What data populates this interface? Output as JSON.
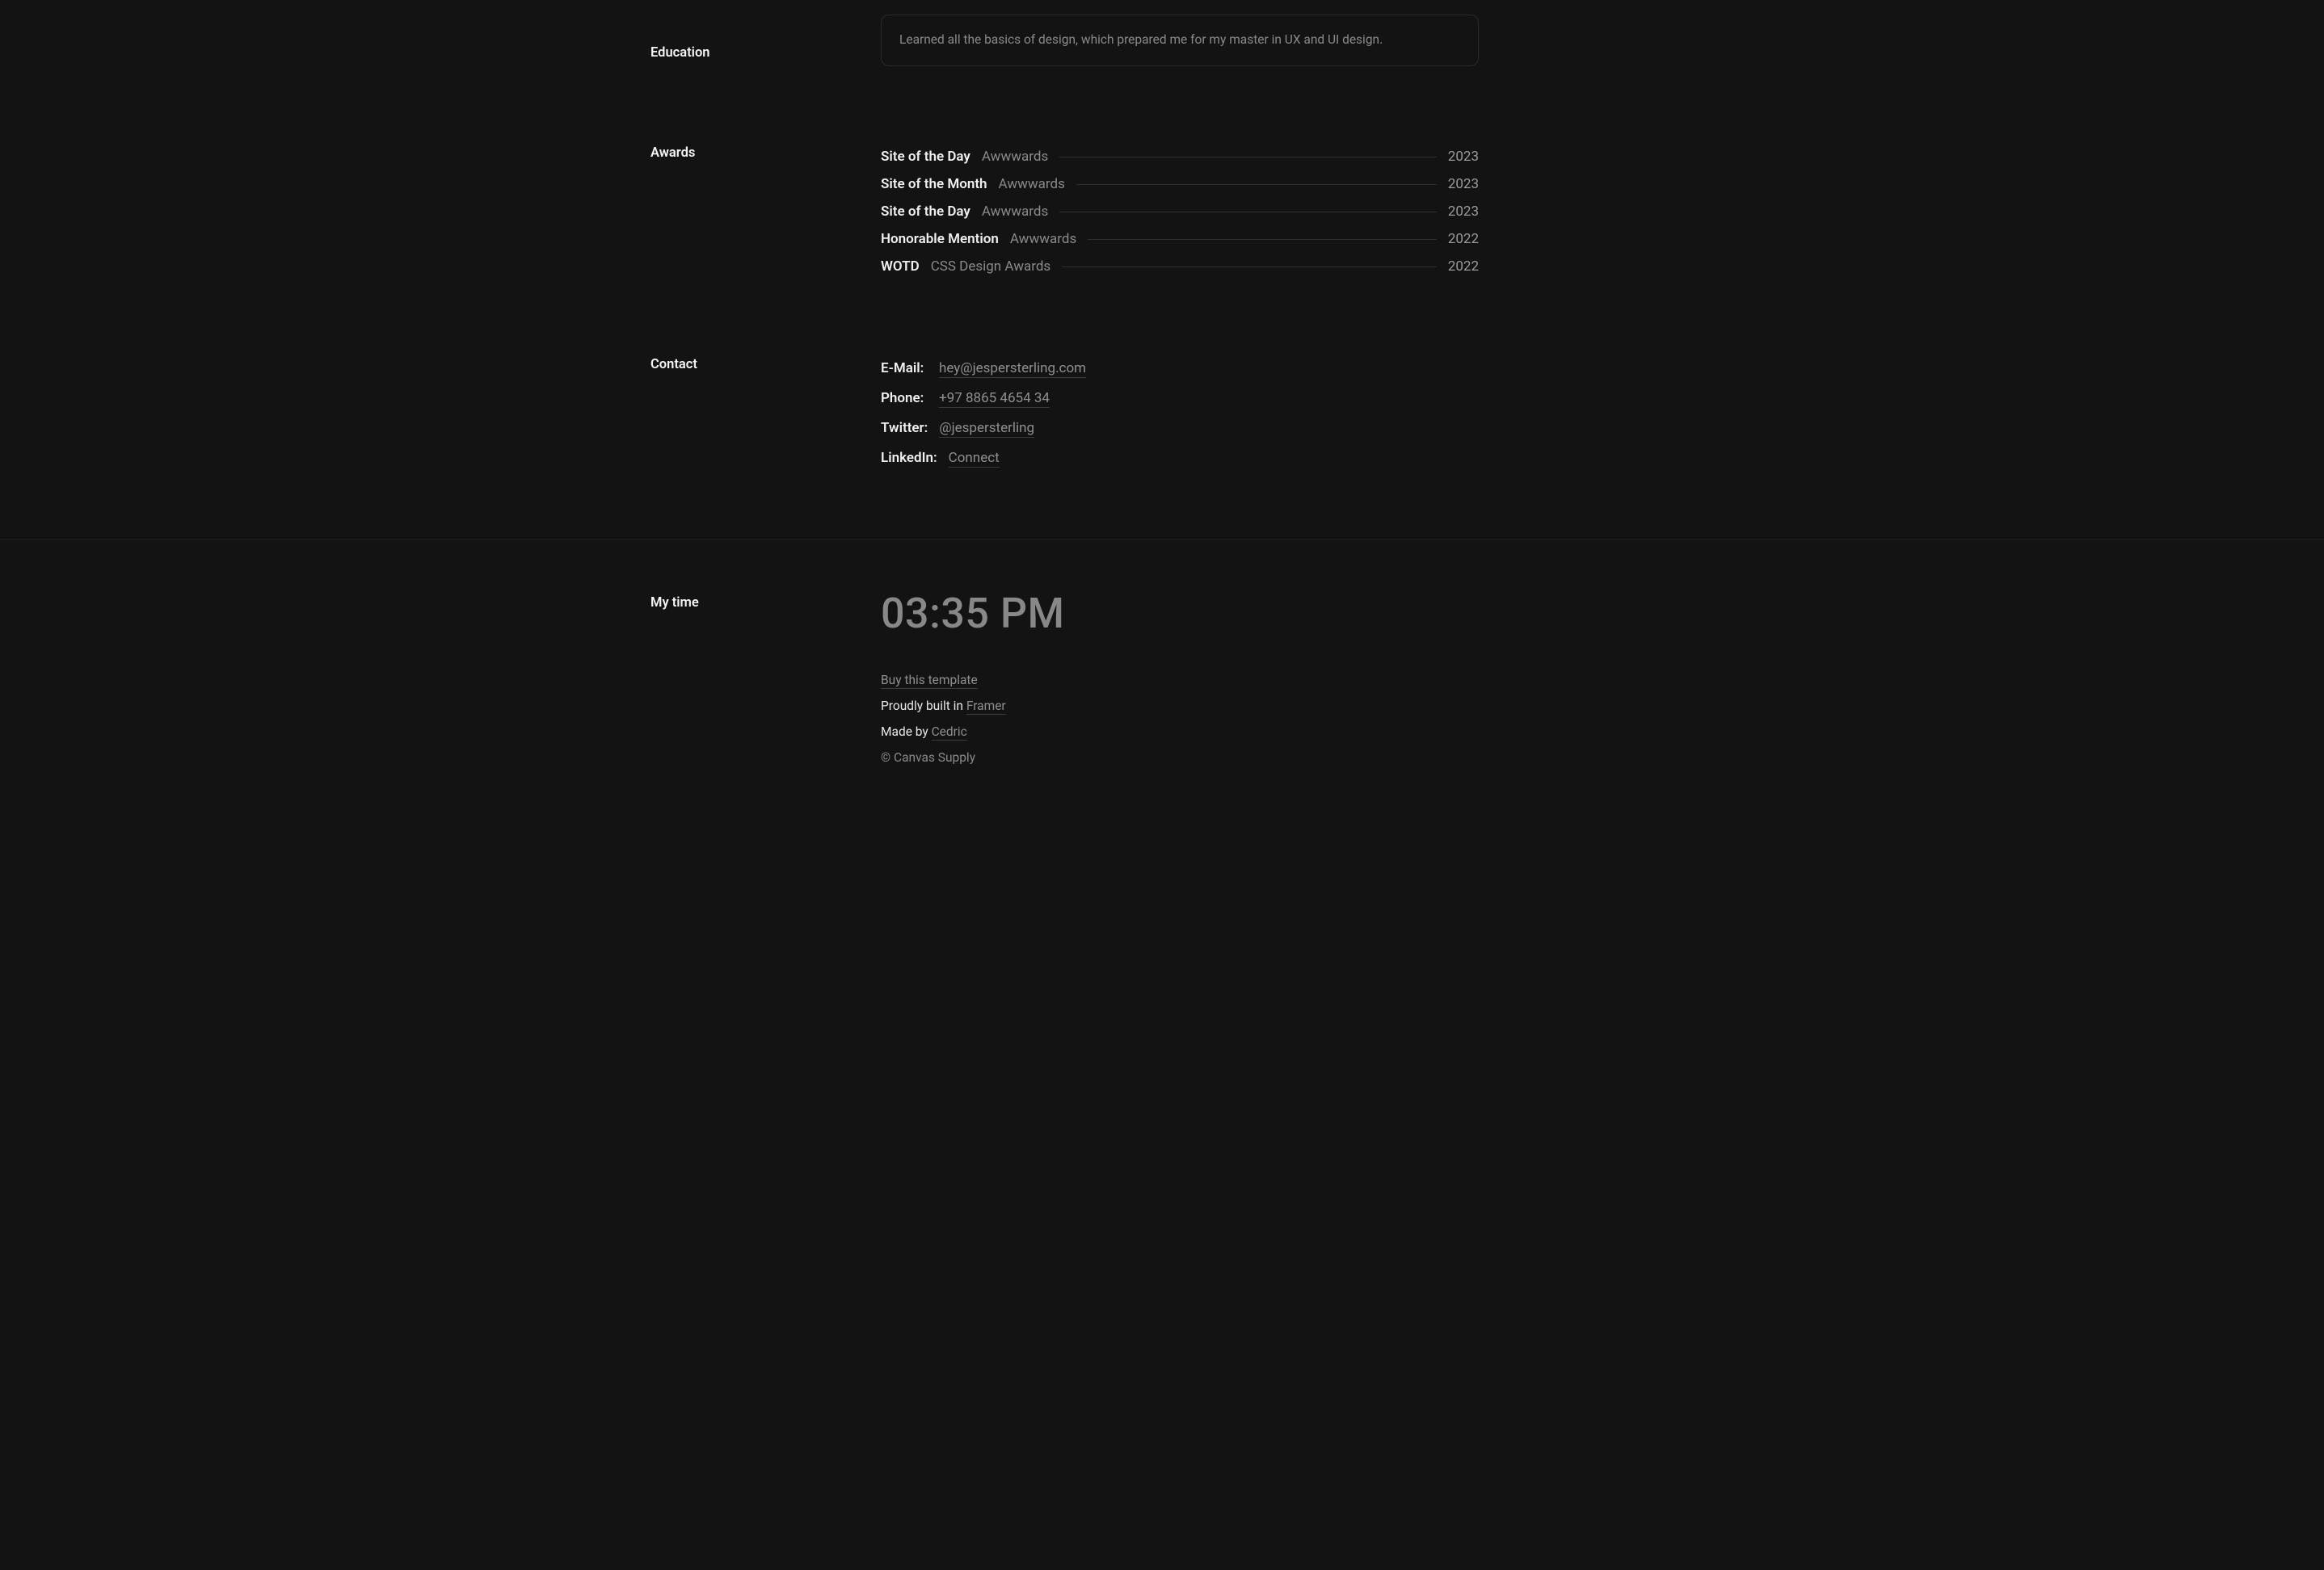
{
  "education": {
    "label": "Education",
    "card_text": "Learned all the basics of design, which prepared me for my master in UX and UI design."
  },
  "awards": {
    "label": "Awards",
    "items": [
      {
        "title": "Site of the Day",
        "org": "Awwwards",
        "year": "2023"
      },
      {
        "title": "Site of the Month",
        "org": "Awwwards",
        "year": "2023"
      },
      {
        "title": "Site of the Day",
        "org": "Awwwards",
        "year": "2023"
      },
      {
        "title": "Honorable Mention",
        "org": "Awwwards",
        "year": "2022"
      },
      {
        "title": "WOTD",
        "org": "CSS Design Awards",
        "year": "2022"
      }
    ]
  },
  "contact": {
    "label": "Contact",
    "items": [
      {
        "key": "E-Mail:",
        "val": "hey@jespersterling.com"
      },
      {
        "key": "Phone:",
        "val": "+97 8865 4654 34"
      },
      {
        "key": "Twitter:",
        "val": "@jespersterling"
      },
      {
        "key": "LinkedIn:",
        "val": "Connect"
      }
    ]
  },
  "mytime": {
    "label": "My time",
    "value": "03:35 PM"
  },
  "footer": {
    "buy": "Buy this template",
    "built_prefix": "Proudly built in ",
    "built_link": "Framer",
    "made_prefix": "Made by ",
    "made_link": "Cedric",
    "copyright": "© Canvas Supply"
  }
}
